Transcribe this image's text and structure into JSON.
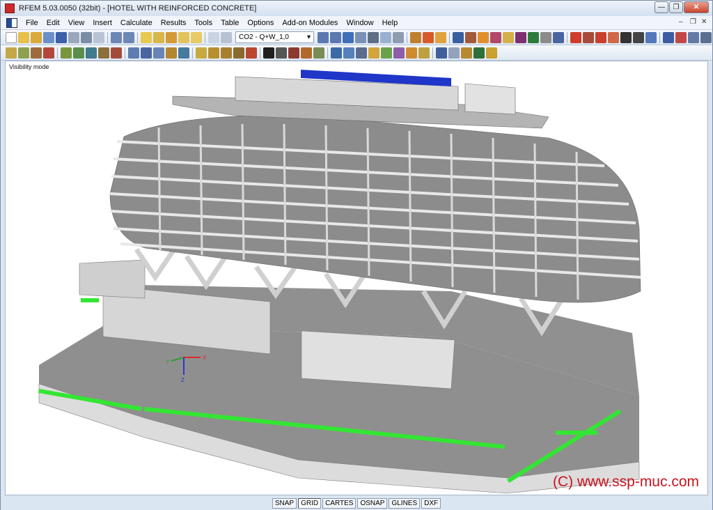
{
  "window": {
    "title": "RFEM 5.03.0050 (32bit) - [HOTEL WITH REINFORCED CONCRETE]"
  },
  "menu": {
    "items": [
      "File",
      "Edit",
      "View",
      "Insert",
      "Calculate",
      "Results",
      "Tools",
      "Table",
      "Options",
      "Add-on Modules",
      "Window",
      "Help"
    ]
  },
  "toolbar": {
    "load_combination": "CO2 - Q+W_1,0"
  },
  "viewport": {
    "mode_label": "Visibility mode",
    "axes": {
      "x": "X",
      "y": "Y",
      "z": "Z"
    },
    "copyright": "(C) www.ssp-muc.com"
  },
  "statusbar": {
    "buttons": [
      "SNAP",
      "GRID",
      "CARTES",
      "OSNAP",
      "GLINES",
      "DXF"
    ]
  },
  "colors": {
    "slab": "#8f8f8f",
    "concrete": "#dcdcdc",
    "support": "#33e633",
    "steel_roof": "#1f36c9"
  }
}
